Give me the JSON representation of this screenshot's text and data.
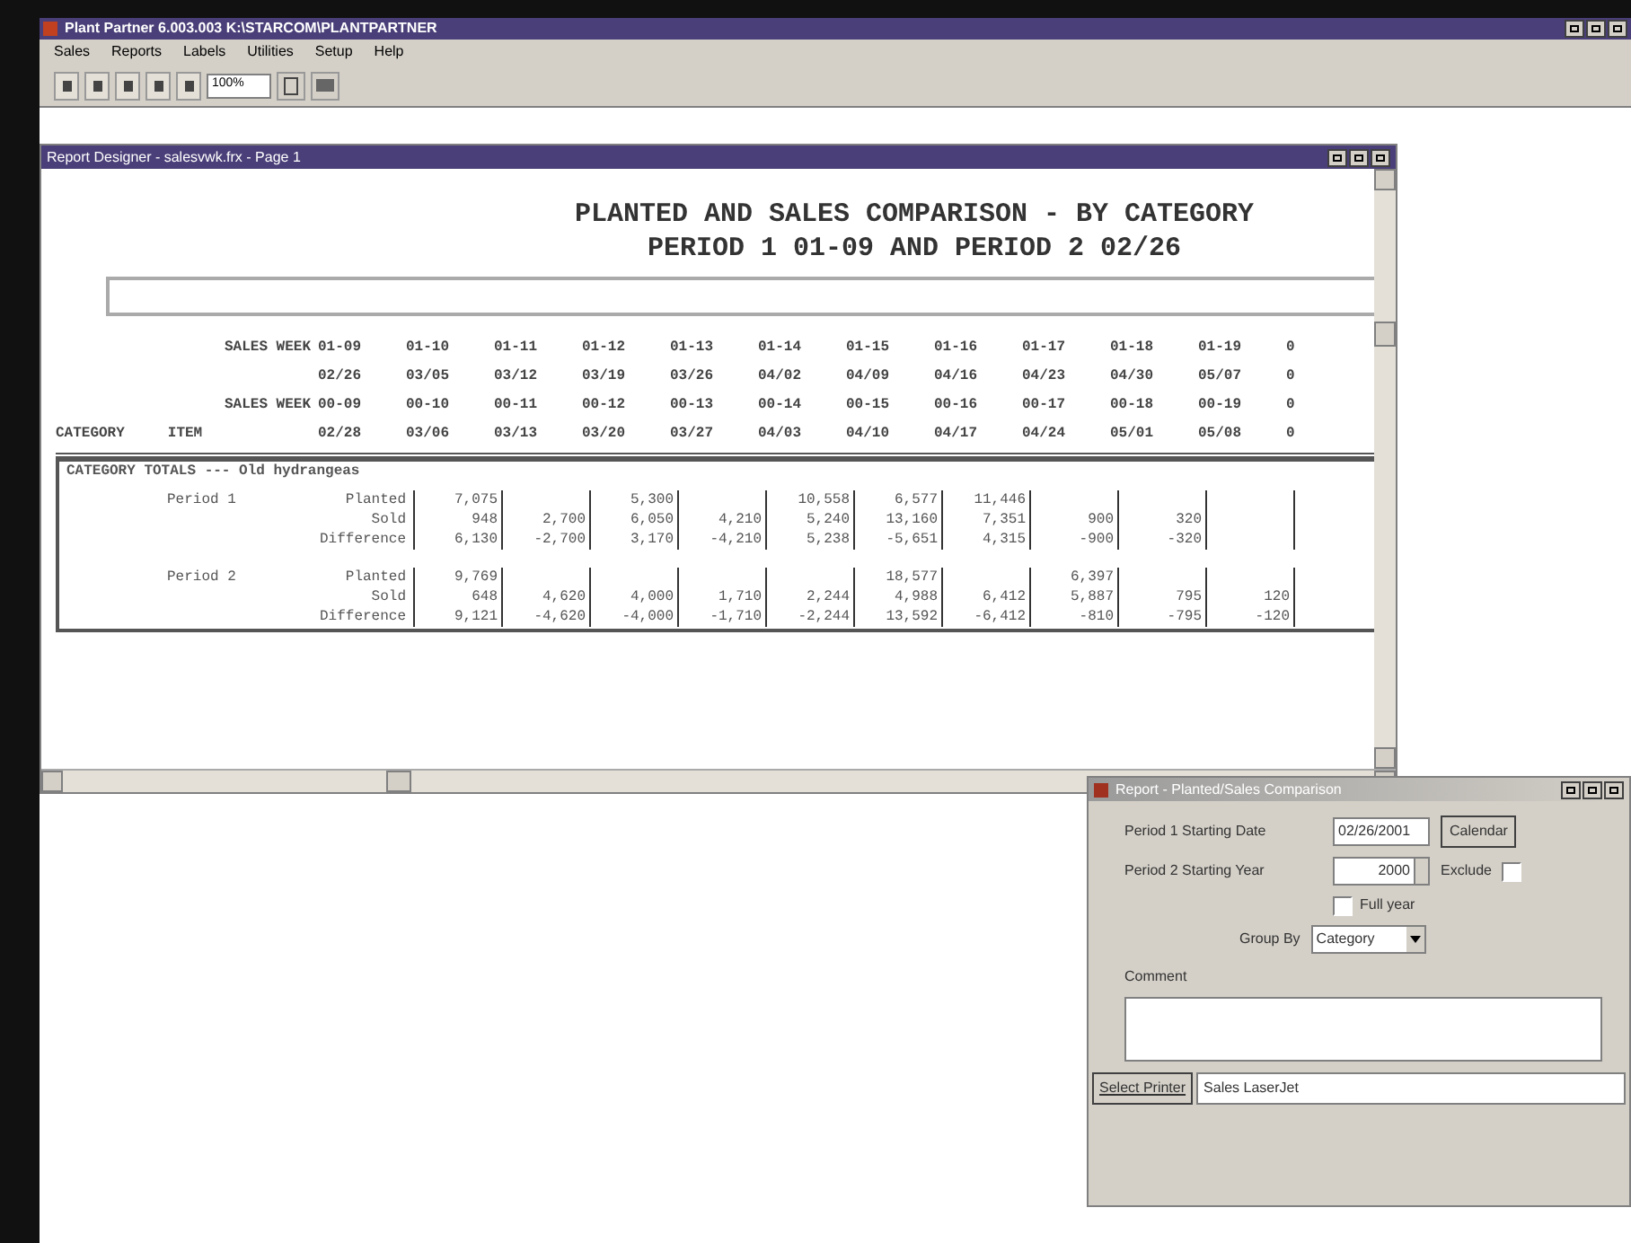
{
  "window": {
    "title": "Plant Partner 6.003.003 K:\\STARCOM\\PLANTPARTNER"
  },
  "menu": [
    "Sales",
    "Reports",
    "Labels",
    "Utilities",
    "Setup",
    "Help"
  ],
  "toolbar": {
    "zoom": "100%"
  },
  "report_window": {
    "title": "Report Designer - salesvwk.frx - Page 1",
    "title_lines": [
      "PLANTED AND SALES COMPARISON - BY CATEGORY",
      "PERIOD 1 01-09 AND PERIOD 2 02/26"
    ],
    "header_rows": [
      {
        "label": "SALES WEEK",
        "values": [
          "01-09",
          "01-10",
          "01-11",
          "01-12",
          "01-13",
          "01-14",
          "01-15",
          "01-16",
          "01-17",
          "01-18",
          "01-19",
          "0"
        ]
      },
      {
        "values": [
          "02/26",
          "03/05",
          "03/12",
          "03/19",
          "03/26",
          "04/02",
          "04/09",
          "04/16",
          "04/23",
          "04/30",
          "05/07",
          "0"
        ]
      },
      {
        "label": "SALES WEEK",
        "values": [
          "00-09",
          "00-10",
          "00-11",
          "00-12",
          "00-13",
          "00-14",
          "00-15",
          "00-16",
          "00-17",
          "00-18",
          "00-19",
          "0"
        ]
      },
      {
        "values": [
          "02/28",
          "03/06",
          "03/13",
          "03/20",
          "03/27",
          "04/03",
          "04/10",
          "04/17",
          "04/24",
          "05/01",
          "05/08",
          "0"
        ]
      }
    ],
    "column_labels": [
      "CATEGORY",
      "ITEM"
    ],
    "group_label": "CATEGORY TOTALS --- Old hydrangeas",
    "periods": [
      {
        "label": "Period 1",
        "rows": [
          {
            "label": "Planted",
            "cells": {
              "column_1": "7,075",
              "column_3": "5,300",
              "column_5": "10,558",
              "column_6": "6,577",
              "column_7": "11,446"
            }
          },
          {
            "label": "Sold",
            "cells": {
              "column_1": "948",
              "column_2": "2,700",
              "column_3": "6,050",
              "column_4": "4,210",
              "column_5": "5,240",
              "column_6": "13,160",
              "column_7": "7,351",
              "column_8": "900",
              "column_9": "320"
            }
          },
          {
            "label": "Difference",
            "cells": {
              "column_1": "6,130",
              "column_2": "-2,700",
              "column_3": "3,170",
              "column_4": "-4,210",
              "column_5": "5,238",
              "column_6": "-5,651",
              "column_7": "4,315",
              "column_8": "-900",
              "column_9": "-320"
            }
          }
        ]
      },
      {
        "label": "Period 2",
        "rows": [
          {
            "label": "Planted",
            "cells": {
              "column_1": "9,769",
              "column_6": "18,577",
              "column_8": "6,397"
            }
          },
          {
            "label": "Sold",
            "cells": {
              "column_1": "648",
              "column_2": "4,620",
              "column_3": "4,000",
              "column_4": "1,710",
              "column_5": "2,244",
              "column_6": "4,988",
              "column_7": "6,412",
              "column_8": "5,887",
              "column_9": "795",
              "column_10": "120"
            }
          },
          {
            "label": "Difference",
            "cells": {
              "column_1": "9,121",
              "column_2": "-4,620",
              "column_3": "-4,000",
              "column_4": "-1,710",
              "column_5": "-2,244",
              "column_6": "13,592",
              "column_7": "-6,412",
              "column_8": "-810",
              "column_9": "-795",
              "column_10": "-120"
            }
          }
        ]
      }
    ]
  },
  "dialog": {
    "title": "Report - Planted/Sales Comparison",
    "period1_label": "Period 1 Starting Date",
    "period1_value": "02/26/2001",
    "calendar_button": "Calendar",
    "period2_label": "Period 2 Starting Year",
    "period2_value": "2000",
    "exclude_label": "Exclude",
    "exclude_checked": false,
    "full_year_label": "Full year",
    "full_year_checked": false,
    "group_by_label": "Group By",
    "group_by_value": "Category",
    "comment_label": "Comment",
    "printer_button": "Select Printer",
    "printer_value": "Sales LaserJet"
  }
}
